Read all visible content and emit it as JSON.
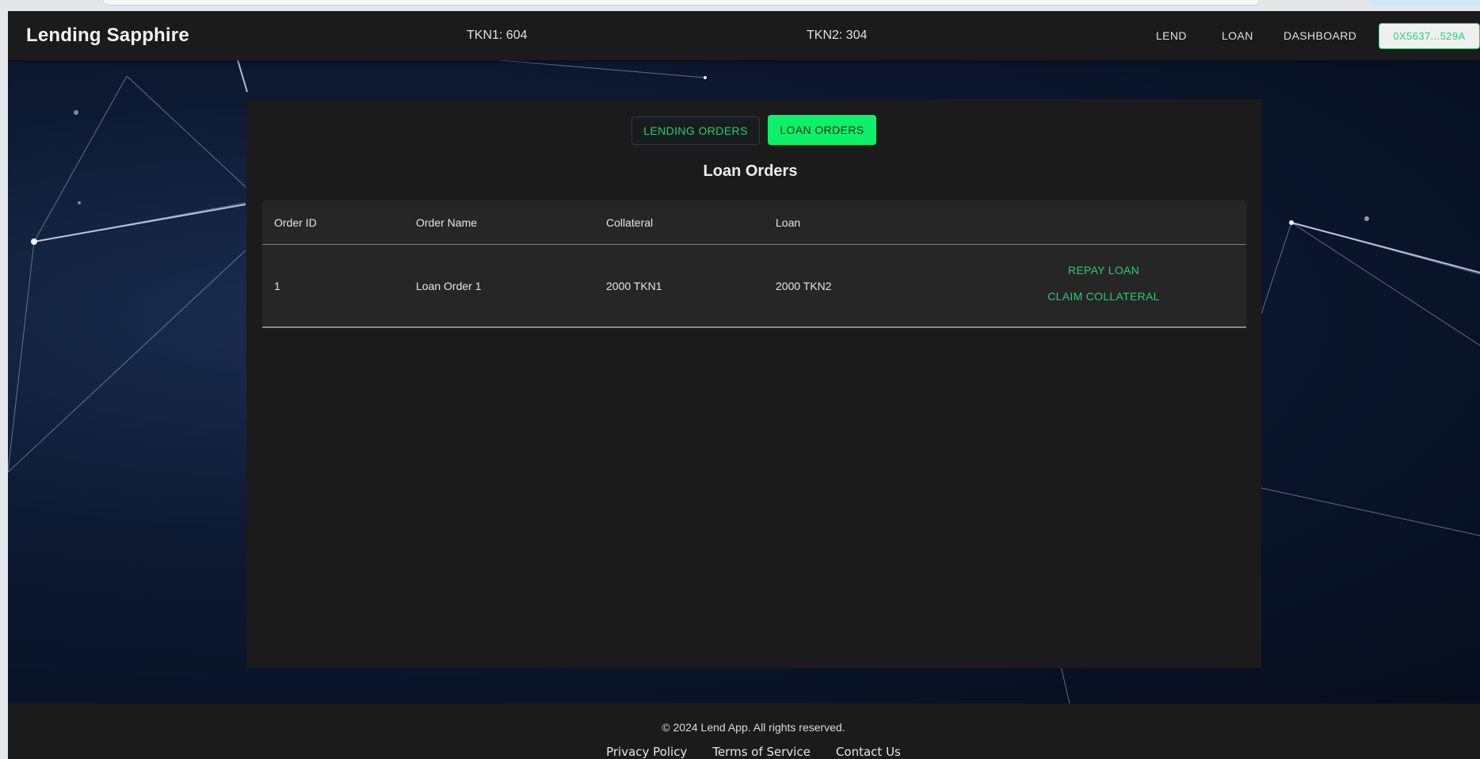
{
  "header": {
    "brand": "Lending Sapphire",
    "balances": {
      "tkn1": "TKN1: 604",
      "tkn2": "TKN2: 304"
    },
    "nav": {
      "lend": "LEND",
      "loan": "LOAN",
      "dashboard": "DASHBOARD"
    },
    "wallet": "0X5637...529A"
  },
  "tabs": {
    "lending": "LENDING ORDERS",
    "loan": "LOAN ORDERS",
    "active": "loan"
  },
  "main": {
    "title": "Loan Orders",
    "table": {
      "columns": [
        "Order ID",
        "Order Name",
        "Collateral",
        "Loan"
      ],
      "rows": [
        {
          "id": "1",
          "name": "Loan Order 1",
          "collateral": "2000 TKN1",
          "loan": "2000 TKN2",
          "actions": [
            "REPAY LOAN",
            "CLAIM COLLATERAL"
          ]
        }
      ]
    }
  },
  "footer": {
    "copyright": "© 2024 Lend App. All rights reserved.",
    "links": [
      "Privacy Policy",
      "Terms of Service",
      "Contact Us"
    ]
  },
  "colors": {
    "accent": "#0ef06a",
    "surface": "#1b1b1b",
    "table": "#262626"
  }
}
